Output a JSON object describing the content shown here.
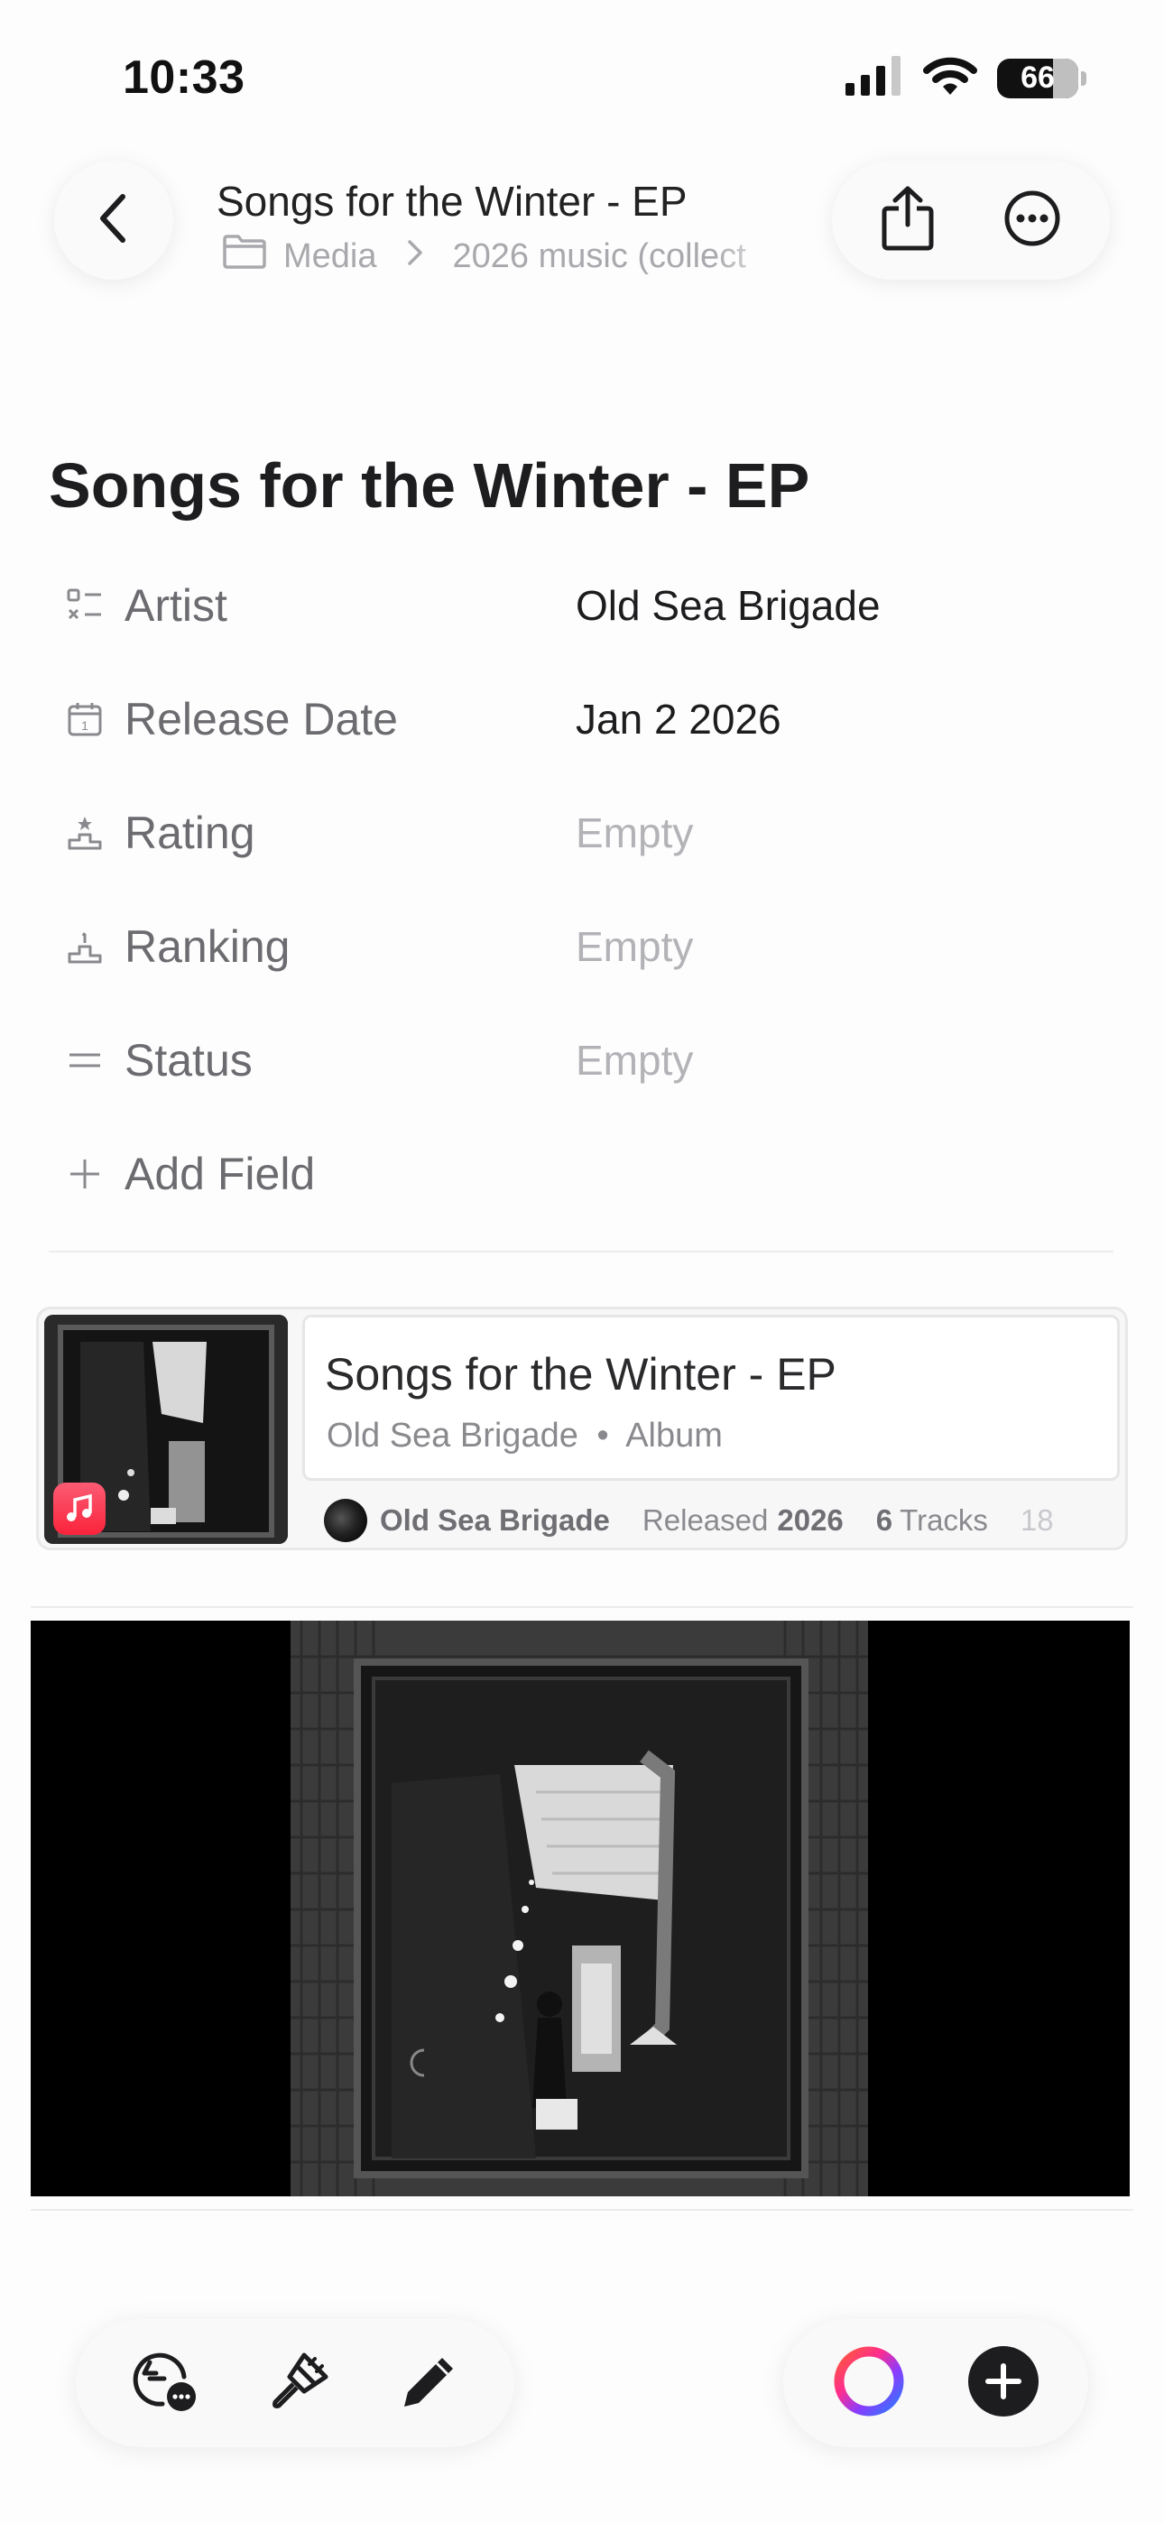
{
  "status_bar": {
    "time": "10:33",
    "battery": "66"
  },
  "header": {
    "title": "Songs for the Winter - EP",
    "breadcrumb": [
      "Media",
      "2026 music (collect"
    ]
  },
  "page": {
    "title": "Songs for the Winter - EP"
  },
  "properties": [
    {
      "icon": "list-check-icon",
      "label": "Artist",
      "value": "Old Sea Brigade",
      "empty": false
    },
    {
      "icon": "calendar-icon",
      "label": "Release Date",
      "value": "Jan 2 2026",
      "empty": false
    },
    {
      "icon": "podium-star-icon",
      "label": "Rating",
      "value": "Empty",
      "empty": true
    },
    {
      "icon": "podium-icon",
      "label": "Ranking",
      "value": "Empty",
      "empty": true
    },
    {
      "icon": "equals-icon",
      "label": "Status",
      "value": "Empty",
      "empty": true
    }
  ],
  "add_field_label": "Add Field",
  "link_card": {
    "title": "Songs for the Winter - EP",
    "subtitle_artist": "Old Sea Brigade",
    "subtitle_type": "Album",
    "meta_artist": "Old Sea Brigade",
    "released_label": "Released",
    "released_year": "2026",
    "tracks_count": "6",
    "tracks_label": "Tracks",
    "overflow_text": "18"
  },
  "colors": {
    "accent_music": "#fa233b",
    "label_gray": "#6b6b70",
    "empty_gray": "#b3b3b7"
  }
}
